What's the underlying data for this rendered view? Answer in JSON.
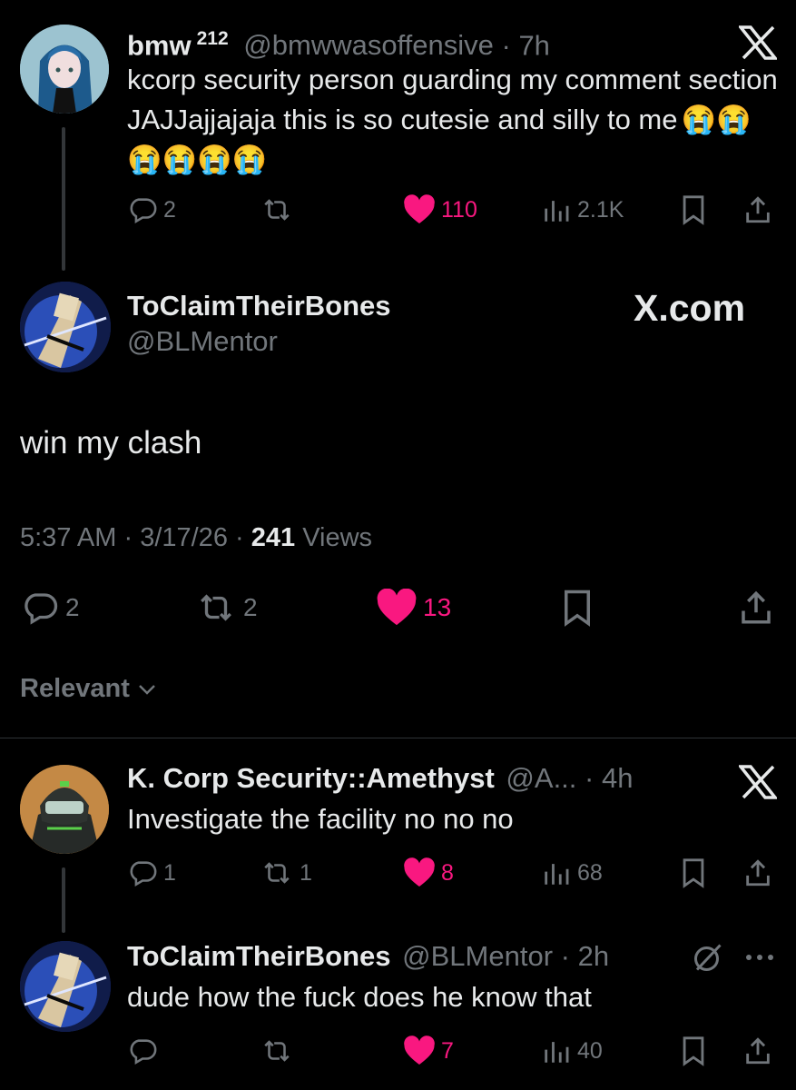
{
  "tweet1": {
    "name": "bmw",
    "badge": "212",
    "handle": "@bmwwasoffensive",
    "time": "7h",
    "text": "kcorp security person guarding my comment section JAJJajjajaja this is so cutesie and silly to me",
    "emoji": "😭😭😭😭😭😭",
    "replies": "2",
    "retweets": "",
    "likes": "110",
    "views": "2.1K"
  },
  "main": {
    "name": "ToClaimTheirBones",
    "handle": "@BLMentor",
    "watermark": "X.com",
    "text": "win my clash",
    "time": "5:37 AM",
    "date": "3/17/26",
    "views_count": "241",
    "views_label": "Views",
    "replies": "2",
    "retweets": "2",
    "likes": "13"
  },
  "sort_label": "Relevant",
  "reply1": {
    "name": "K. Corp Security::Amethyst",
    "handle": "@A...",
    "time": "4h",
    "text": "Investigate the facility no no no",
    "replies": "1",
    "retweets": "1",
    "likes": "8",
    "views": "68"
  },
  "reply2": {
    "name": "ToClaimTheirBones",
    "handle": "@BLMentor",
    "time": "2h",
    "text": "dude how the fuck does he know that",
    "replies": "",
    "retweets": "",
    "likes": "7",
    "views": "40"
  },
  "colors": {
    "background": "#000000",
    "text": "#e7e9ea",
    "muted": "#71767b",
    "like": "#f91880",
    "line": "#333639"
  }
}
